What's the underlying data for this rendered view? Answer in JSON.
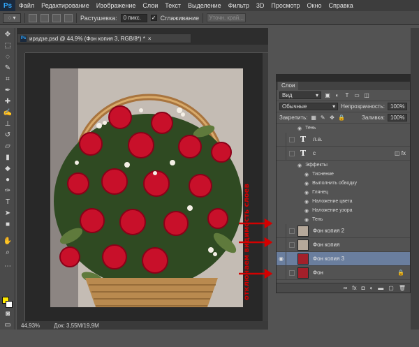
{
  "menu": {
    "logo": "Ps",
    "items": [
      "Файл",
      "Редактирование",
      "Изображение",
      "Слои",
      "Текст",
      "Выделение",
      "Фильтр",
      "3D",
      "Просмотр",
      "Окно",
      "Справка"
    ]
  },
  "options": {
    "feather_label": "Растушевка:",
    "feather_value": "0 пикс.",
    "antialias_label": "Сглаживание",
    "refine_button": "Уточн. край..."
  },
  "document": {
    "title": "ирадзе.psd @ 44,9% (Фон копия 3, RGB/8*) *",
    "zoom": "44,93%",
    "doc_size": "Док: 3,55M/19,9M"
  },
  "annotation": {
    "text": "отключаем видимость слоев"
  },
  "layers_panel": {
    "tab": "Слои",
    "filter_label": "Вид",
    "blend_mode": "Обычные",
    "opacity_label": "Непрозрачность:",
    "opacity_value": "100%",
    "lock_label": "Закрепить:",
    "fill_label": "Заливка:",
    "fill_value": "100%",
    "layers": [
      {
        "name": "Тень"
      },
      {
        "name": "л.а."
      },
      {
        "name": "с"
      },
      {
        "name": "Фон копия 2"
      },
      {
        "name": "Фон копия"
      },
      {
        "name": "Фон копия 3"
      },
      {
        "name": "Фон"
      }
    ],
    "effects_label": "Эффекты",
    "effects": [
      "Тиснение",
      "Выполнить обводку",
      "Глянец",
      "Наложение цвета",
      "Наложение узора",
      "Тень"
    ]
  },
  "colors": {
    "foreground": "#ffe800",
    "background": "#ffffff",
    "selected_layer": "#6a7e9e",
    "annotation": "#d40000"
  }
}
